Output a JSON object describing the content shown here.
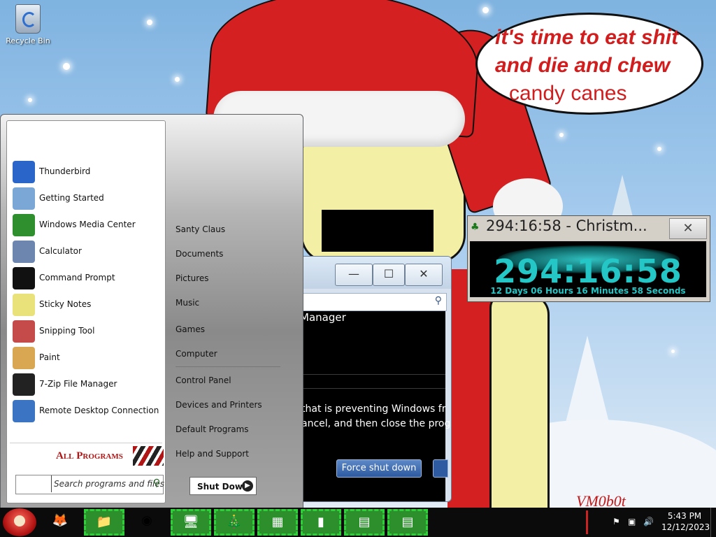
{
  "desktop": {
    "recycle_bin_label": "Recycle Bin",
    "speech_line1": "it's time to eat shit",
    "speech_line2": "and die and chew",
    "speech_line3": "candy canes",
    "watermark": "VM0b0t"
  },
  "dialog": {
    "title_fragment": "Manager",
    "message_line1": "that is preventing Windows fr",
    "message_line2": "ancel, and then close the prog",
    "force_button": "Force shut down",
    "minimize_glyph": "—",
    "maximize_glyph": "☐",
    "close_glyph": "✕"
  },
  "gadget": {
    "title": "294:16:58 - Christm...",
    "close_glyph": "✕",
    "big_time": "294:16:58",
    "detail": "12 Days 06 Hours 16 Minutes 58 Seconds",
    "accent": "#24c6c6"
  },
  "start_menu": {
    "programs": [
      {
        "label": "Thunderbird",
        "icon": "thunderbird-icon",
        "color": "#2a66c9"
      },
      {
        "label": "Getting Started",
        "icon": "getting-started-icon",
        "color": "#7aa7d6"
      },
      {
        "label": "Windows Media Center",
        "icon": "media-center-icon",
        "color": "#2f8f2f"
      },
      {
        "label": "Calculator",
        "icon": "calculator-icon",
        "color": "#6d86b0"
      },
      {
        "label": "Command Prompt",
        "icon": "command-prompt-icon",
        "color": "#111111"
      },
      {
        "label": "Sticky Notes",
        "icon": "sticky-notes-icon",
        "color": "#e9e27a"
      },
      {
        "label": "Snipping Tool",
        "icon": "snipping-tool-icon",
        "color": "#c54b4b"
      },
      {
        "label": "Paint",
        "icon": "paint-icon",
        "color": "#d9a652"
      },
      {
        "label": "7-Zip File Manager",
        "icon": "seven-zip-icon",
        "color": "#222222"
      },
      {
        "label": "Remote Desktop Connection",
        "icon": "remote-desktop-icon",
        "color": "#3b74c2"
      }
    ],
    "all_programs": "All Programs",
    "search_placeholder": "Search programs and files",
    "right_items": [
      {
        "label": "Santy Claus",
        "name": "start-menu-user-folder"
      },
      {
        "label": "Documents",
        "name": "start-menu-documents"
      },
      {
        "label": "Pictures",
        "name": "start-menu-pictures"
      },
      {
        "label": "Music",
        "name": "start-menu-music"
      },
      {
        "label": "Games",
        "name": "start-menu-games"
      },
      {
        "label": "Computer",
        "name": "start-menu-computer"
      },
      {
        "label": "Control Panel",
        "name": "start-menu-control-panel"
      },
      {
        "label": "Devices and Printers",
        "name": "start-menu-devices-printers"
      },
      {
        "label": "Default Programs",
        "name": "start-menu-default-programs"
      },
      {
        "label": "Help and Support",
        "name": "start-menu-help-support"
      }
    ],
    "shutdown_label": "Shut Down",
    "shutdown_arrow": "▶"
  },
  "taskbar": {
    "start_glyph": "",
    "clock_time": "5:43 PM",
    "clock_date": "12/12/2023",
    "buttons": [
      {
        "icon": "firefox-icon",
        "glyph": "🦊"
      },
      {
        "icon": "explorer-icon",
        "glyph": "📁"
      },
      {
        "icon": "chrome-icon",
        "glyph": "◉"
      },
      {
        "icon": "remote-desktop-icon",
        "glyph": "🖥"
      },
      {
        "icon": "christmas-tree-icon",
        "glyph": "🎄"
      },
      {
        "icon": "control-panel-icon",
        "glyph": "▦"
      },
      {
        "icon": "folder-icon",
        "glyph": "▮"
      },
      {
        "icon": "window-icon",
        "glyph": "▤"
      },
      {
        "icon": "window-icon",
        "glyph": "▤"
      }
    ],
    "tray": {
      "flag": "⚑",
      "network": "▣",
      "volume": "🔊",
      "arrow": "▲"
    }
  }
}
